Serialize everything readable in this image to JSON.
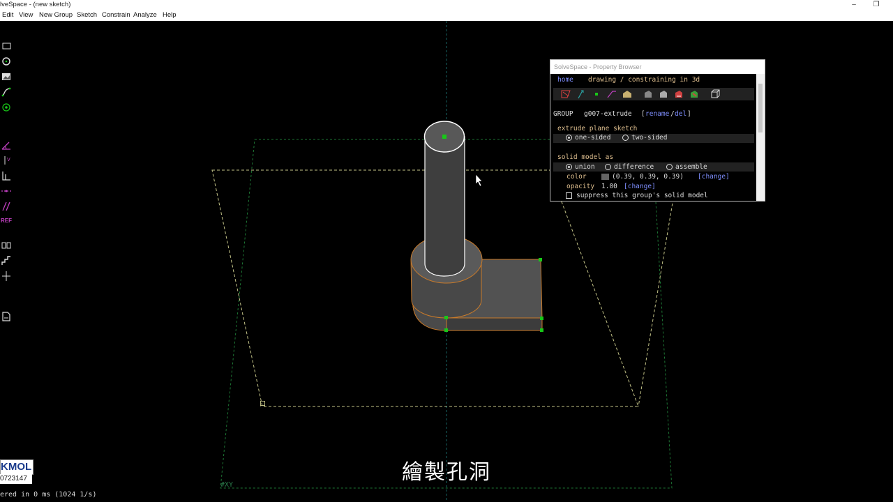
{
  "window": {
    "title": "lveSpace - (new sketch)",
    "controls": [
      "–",
      "❐"
    ]
  },
  "menu": [
    "Edit",
    "View",
    "New Group",
    "Sketch",
    "Constrain",
    "Analyze",
    "Help"
  ],
  "toolbar_icons": [
    "rectangle-icon",
    "circle-icon",
    "image-icon",
    "spline-icon",
    "point-icon",
    "angle-icon",
    "vertical-icon",
    "horizontal-icon",
    "perpendicular-icon",
    "parallel-icon",
    "reference-icon",
    "symmetric-icon",
    "step-icon",
    "axis-icon",
    "doc-icon"
  ],
  "toolbar_ref_label": "REF",
  "canvas": {
    "xy_label": "#XY",
    "origin_label": "口"
  },
  "property_browser": {
    "window_title": "SolveSpace - Property Browser",
    "nav_home": "home",
    "nav_mode": "drawing / constraining in 3d",
    "group_prefix": "GROUP",
    "group_name": "g007-extrude",
    "rename": "rename",
    "slash": "/",
    "del": "del",
    "extrude_heading": "extrude plane sketch",
    "one_sided": "one-sided",
    "two_sided": "two-sided",
    "solid_heading": "solid model as",
    "union": "union",
    "difference": "difference",
    "assemble": "assemble",
    "color_label": "color",
    "color_value": "(0.39, 0.39, 0.39)",
    "color_hex": "#646464",
    "change": "[change]",
    "opacity_label": "opacity",
    "opacity_value": "1.00",
    "suppress": "suppress this group's solid model"
  },
  "status_text": "ered in 0 ms (1024 1/s)",
  "subtitle": "繪製孔洞",
  "logo": {
    "text": "KMOL",
    "sub": "0723147"
  },
  "colors": {
    "accent_link": "#7f8fff",
    "heading": "#e0c090",
    "solid": "#5a5a5a",
    "edge": "#c87a2a",
    "point": "#18c818"
  }
}
